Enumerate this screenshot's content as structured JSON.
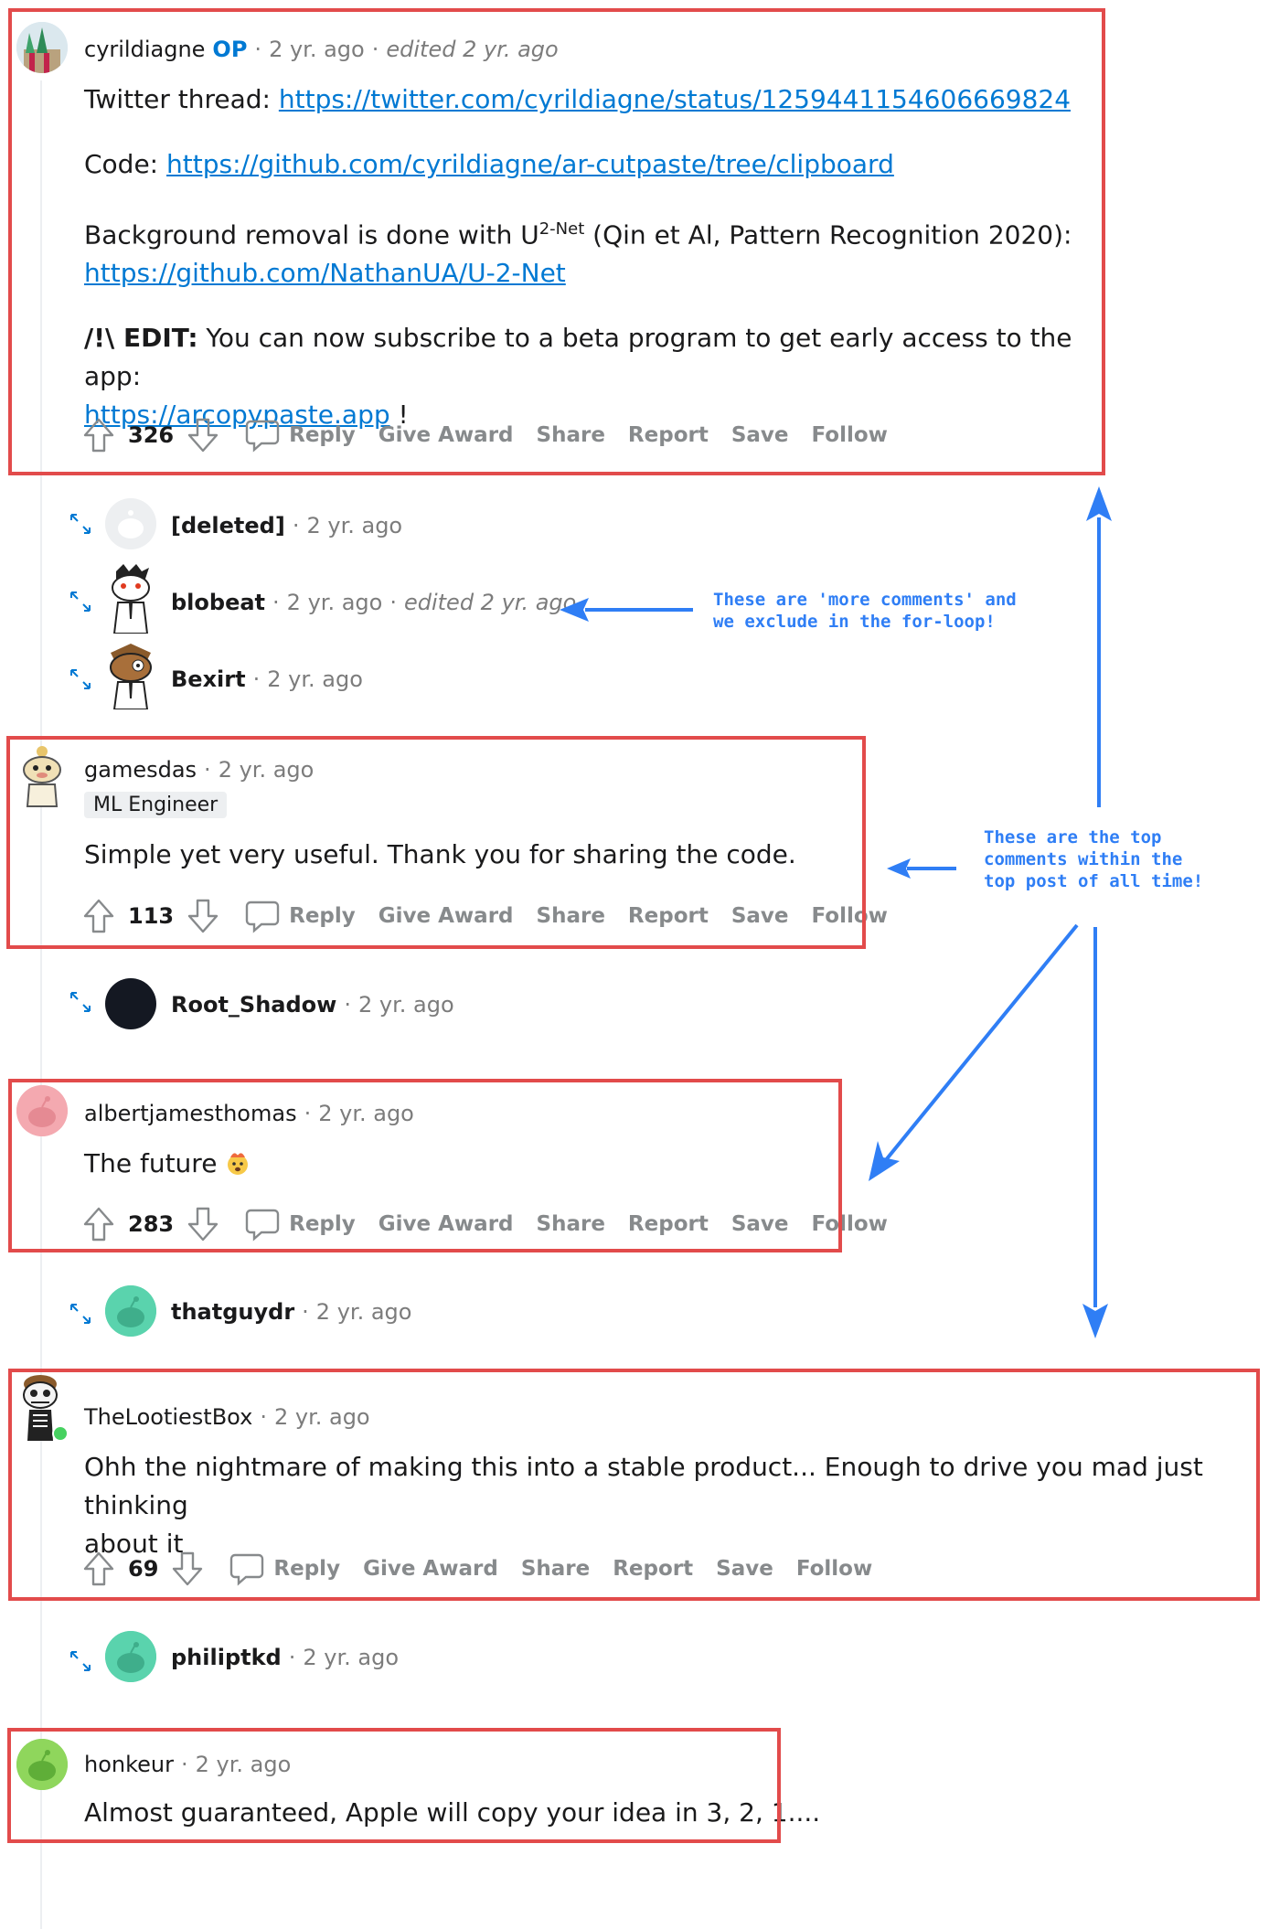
{
  "comments": [
    {
      "user": "cyrildiagne",
      "op_badge": "OP",
      "time": "2 yr. ago",
      "edited": "edited 2 yr. ago",
      "twitter_label": "Twitter thread: ",
      "twitter_link": "https://twitter.com/cyrildiagne/status/1259441154606669824",
      "code_label": "Code: ",
      "code_link": "https://github.com/cyrildiagne/ar-cutpaste/tree/clipboard",
      "bg_text_a": "Background removal is done with U",
      "bg_sup": "2-Net",
      "bg_text_b": " (Qin et Al, Pattern Recognition 2020):",
      "bg_link": "https://github.com/NathanUA/U-2-Net",
      "edit_bold": "/!\\ EDIT:",
      "edit_text": " You can now subscribe to a beta program to get early access to the app:",
      "edit_link": "https://arcopypaste.app",
      "edit_tail": " !",
      "score": "326"
    },
    {
      "user": "gamesdas",
      "time": "2 yr. ago",
      "flair": "ML Engineer",
      "text": "Simple yet very useful. Thank you for sharing the code.",
      "score": "113"
    },
    {
      "user": "albertjamesthomas",
      "time": "2 yr. ago",
      "text": "The future",
      "score": "283"
    },
    {
      "user": "TheLootiestBox",
      "time": "2 yr. ago",
      "text_line1": "Ohh the nightmare of making this into a stable product... Enough to drive you mad just thinking",
      "text_line2": "about it",
      "score": "69"
    },
    {
      "user": "honkeur",
      "time": "2 yr. ago",
      "text": "Almost guaranteed, Apple will copy your idea in 3, 2, 1...."
    }
  ],
  "collapsed": [
    {
      "user": "[deleted]",
      "time": "2 yr. ago"
    },
    {
      "user": "blobeat",
      "time": "2 yr. ago",
      "edited": "edited 2 yr. ago"
    },
    {
      "user": "Bexirt",
      "time": "2 yr. ago"
    },
    {
      "user": "Root_Shadow",
      "time": "2 yr. ago"
    },
    {
      "user": "thatguydr",
      "time": "2 yr. ago"
    },
    {
      "user": "philiptkd",
      "time": "2 yr. ago"
    }
  ],
  "actions": {
    "reply": "Reply",
    "give_award": "Give Award",
    "share": "Share",
    "report": "Report",
    "save": "Save",
    "follow": "Follow"
  },
  "annotations": {
    "more_comments_line1": "These are 'more comments' and",
    "more_comments_line2": "we exclude in the for-loop!",
    "top_comments_line1": "These are the top",
    "top_comments_line2": "comments within the",
    "top_comments_line3": "top post of all time!"
  },
  "colors": {
    "highlight_box": "#e24b4b",
    "annotation": "#2f7ef5",
    "link": "#0079d3",
    "op": "#0079d3"
  }
}
